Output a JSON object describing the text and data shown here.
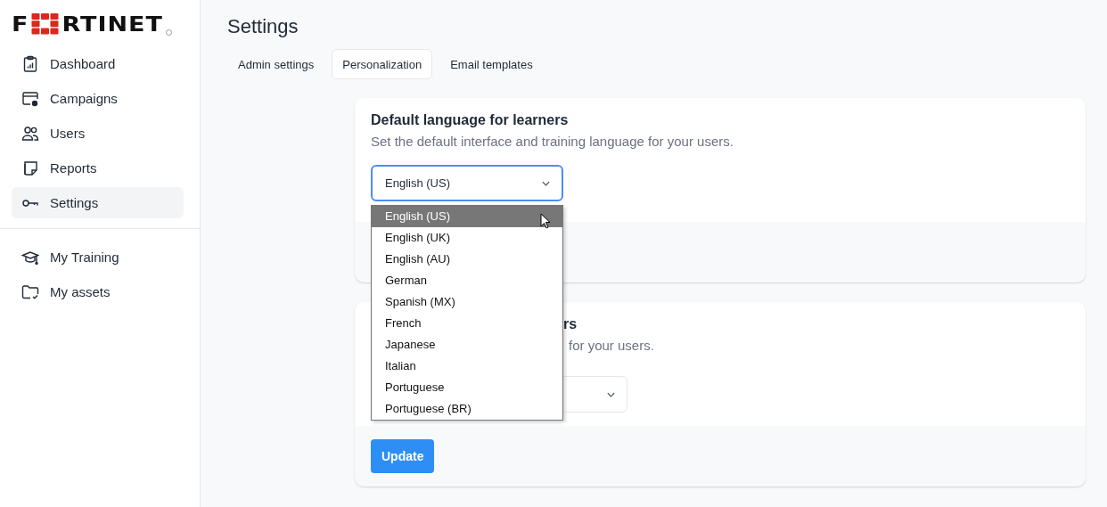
{
  "logo": {
    "before": "F",
    "after": "RTINET"
  },
  "sidebar": {
    "items": [
      {
        "label": "Dashboard",
        "selected": false
      },
      {
        "label": "Campaigns",
        "selected": false
      },
      {
        "label": "Users",
        "selected": false
      },
      {
        "label": "Reports",
        "selected": false
      },
      {
        "label": "Settings",
        "selected": true
      }
    ],
    "secondary_items": [
      {
        "label": "My Training",
        "selected": false
      },
      {
        "label": "My assets",
        "selected": false
      }
    ]
  },
  "page_title": "Settings",
  "tabs": [
    {
      "label": "Admin settings",
      "selected": false
    },
    {
      "label": "Personalization",
      "selected": true
    },
    {
      "label": "Email templates",
      "selected": false
    }
  ],
  "cards": [
    {
      "title": "Default language for learners",
      "description": "Set the default interface and training language for your users.",
      "select": {
        "value": "English (US)",
        "focused": true,
        "open": true,
        "options": [
          {
            "label": "English (US)",
            "selected": true
          },
          {
            "label": "English (UK)",
            "selected": false
          },
          {
            "label": "English (AU)",
            "selected": false
          },
          {
            "label": "German",
            "selected": false
          },
          {
            "label": "Spanish (MX)",
            "selected": false
          },
          {
            "label": "French",
            "selected": false
          },
          {
            "label": "Japanese",
            "selected": false
          },
          {
            "label": "Italian",
            "selected": false
          },
          {
            "label": "Portuguese",
            "selected": false
          },
          {
            "label": "Portuguese (BR)",
            "selected": false
          }
        ]
      }
    },
    {
      "title": "rs",
      "description": "for your users.",
      "select": {
        "focused": false
      },
      "button": "Update"
    }
  ]
}
